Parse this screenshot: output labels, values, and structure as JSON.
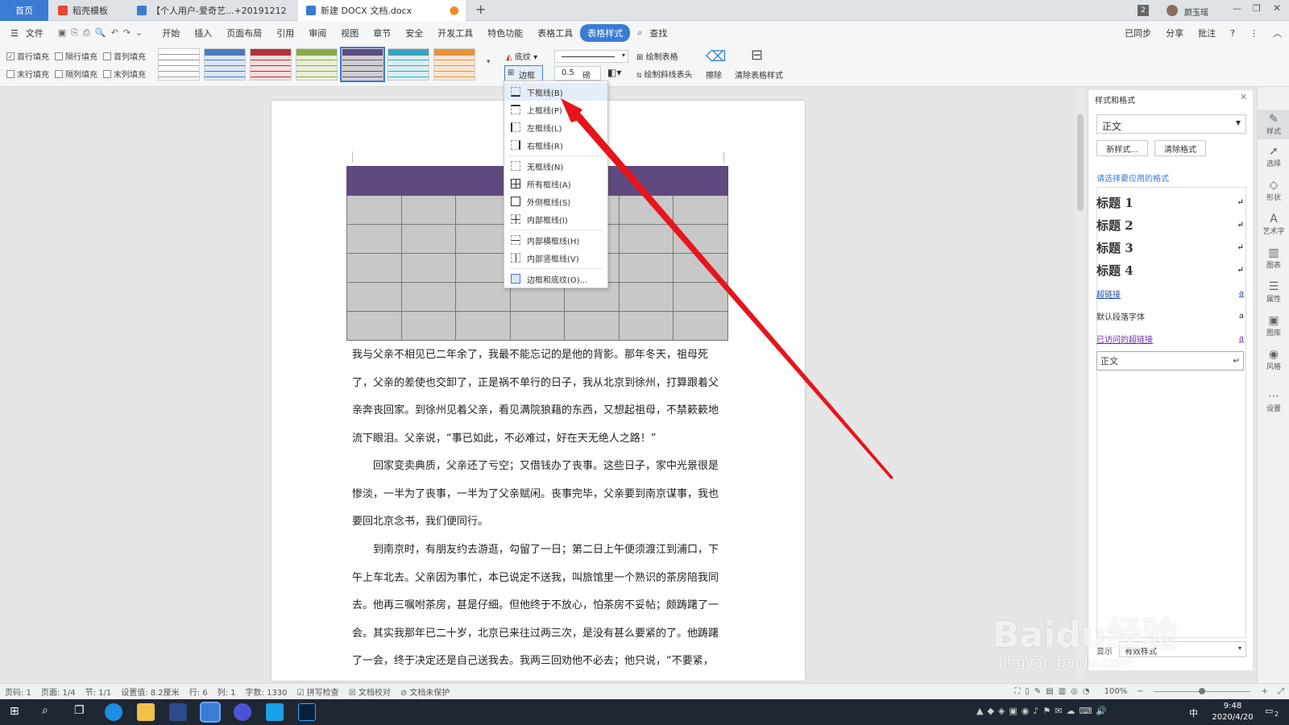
{
  "tabs": [
    {
      "label": "首页"
    },
    {
      "label": "稻壳模板"
    },
    {
      "label": "【个人用户-爱奇艺...+20191212"
    },
    {
      "label": "新建 DOCX 文档.docx"
    }
  ],
  "window": {
    "badge": "2",
    "user": "颜玉瑶"
  },
  "menu": {
    "file": "文件",
    "items": [
      "开始",
      "插入",
      "页面布局",
      "引用",
      "审阅",
      "视图",
      "章节",
      "安全",
      "开发工具",
      "特色功能",
      "表格工具",
      "表格样式"
    ],
    "search": "查找",
    "sync": "已同步",
    "share": "分享",
    "comment": "批注"
  },
  "ribbon": {
    "checks": [
      "首行填充",
      "隔行填充",
      "首列填充",
      "末行填充",
      "隔列填充",
      "末列填充"
    ],
    "shading": "底纹",
    "border": "边框",
    "line_width": "0.5",
    "line_unit": "磅",
    "draw_table": "绘制表格",
    "draw_diagonal": "绘制斜线表头",
    "erase": "擦除",
    "clear_style": "清除表格样式"
  },
  "dropdown": {
    "items": [
      "下框线(B)",
      "上框线(P)",
      "左框线(L)",
      "右框线(R)",
      "无框线(N)",
      "所有框线(A)",
      "外侧框线(S)",
      "内部框线(I)",
      "内部横框线(H)",
      "内部竖框线(V)",
      "边框和底纹(O)..."
    ]
  },
  "document": {
    "paragraphs": [
      "我与父亲不相见已二年余了，我最不能忘记的是他的背影。那年冬天，祖母死了，父亲的差使也交卸了，正是祸不单行的日子，我从北京到徐州，打算跟着父亲奔丧回家。到徐州见着父亲，看见满院狼藉的东西，又想起祖母，不禁簌簌地流下眼泪。父亲说，“事已如此，不必难过，好在天无绝人之路！”",
      "回家变卖典质，父亲还了亏空；又借钱办了丧事。这些日子，家中光景很是惨淡，一半为了丧事，一半为了父亲赋闲。丧事完毕，父亲要到南京谋事，我也要回北京念书，我们便同行。",
      "到南京时，有朋友约去游逛，勾留了一日；第二日上午便须渡江到浦口，下午上车北去。父亲因为事忙，本已说定不送我，叫旅馆里一个熟识的茶房陪我同去。他再三嘱咐茶房，甚是仔细。但他终于不放心，怕茶房不妥帖；颇踌躇了一会。其实我那年已二十岁，北京已来往过两三次，是没有甚么要紧的了。他踌躇了一会，终于决定还是自己送我去。我两三回劝他不必去；他只说，“不要紧，"
    ]
  },
  "side_panel": {
    "title": "样式和格式",
    "current": "正文",
    "new_style": "新样式...",
    "clear_format": "清除格式",
    "prompt": "请选择要应用的格式",
    "styles": [
      "标题 1",
      "标题 2",
      "标题 3",
      "标题 4",
      "超链接",
      "默认段落字体",
      "已访问的超链接",
      "正文"
    ],
    "show": "显示",
    "show_value": "有效样式"
  },
  "right_bar": [
    "样式",
    "选择",
    "形状",
    "艺术字",
    "图表",
    "属性",
    "图库",
    "风格",
    "设置"
  ],
  "status": {
    "page_no": "页码: 1",
    "pages": "页面: 1/4",
    "section": "节: 1/1",
    "setting": "设置值: 8.2厘米",
    "row": "行: 6",
    "col": "列: 1",
    "words": "字数: 1330",
    "spell": "拼写检查",
    "proof": "文档校对",
    "protect": "文档未保护",
    "zoom": "100%"
  },
  "taskbar": {
    "time": "9:48",
    "date": "2020/4/20",
    "ime": "中",
    "notif": "2"
  },
  "watermark": {
    "text": "Baidu经验",
    "url": "jingyan.baidu.com"
  },
  "colors": {
    "accent": "#3a7bd5",
    "header_row": "#5e4a7f",
    "arrow": "#e8141b"
  }
}
